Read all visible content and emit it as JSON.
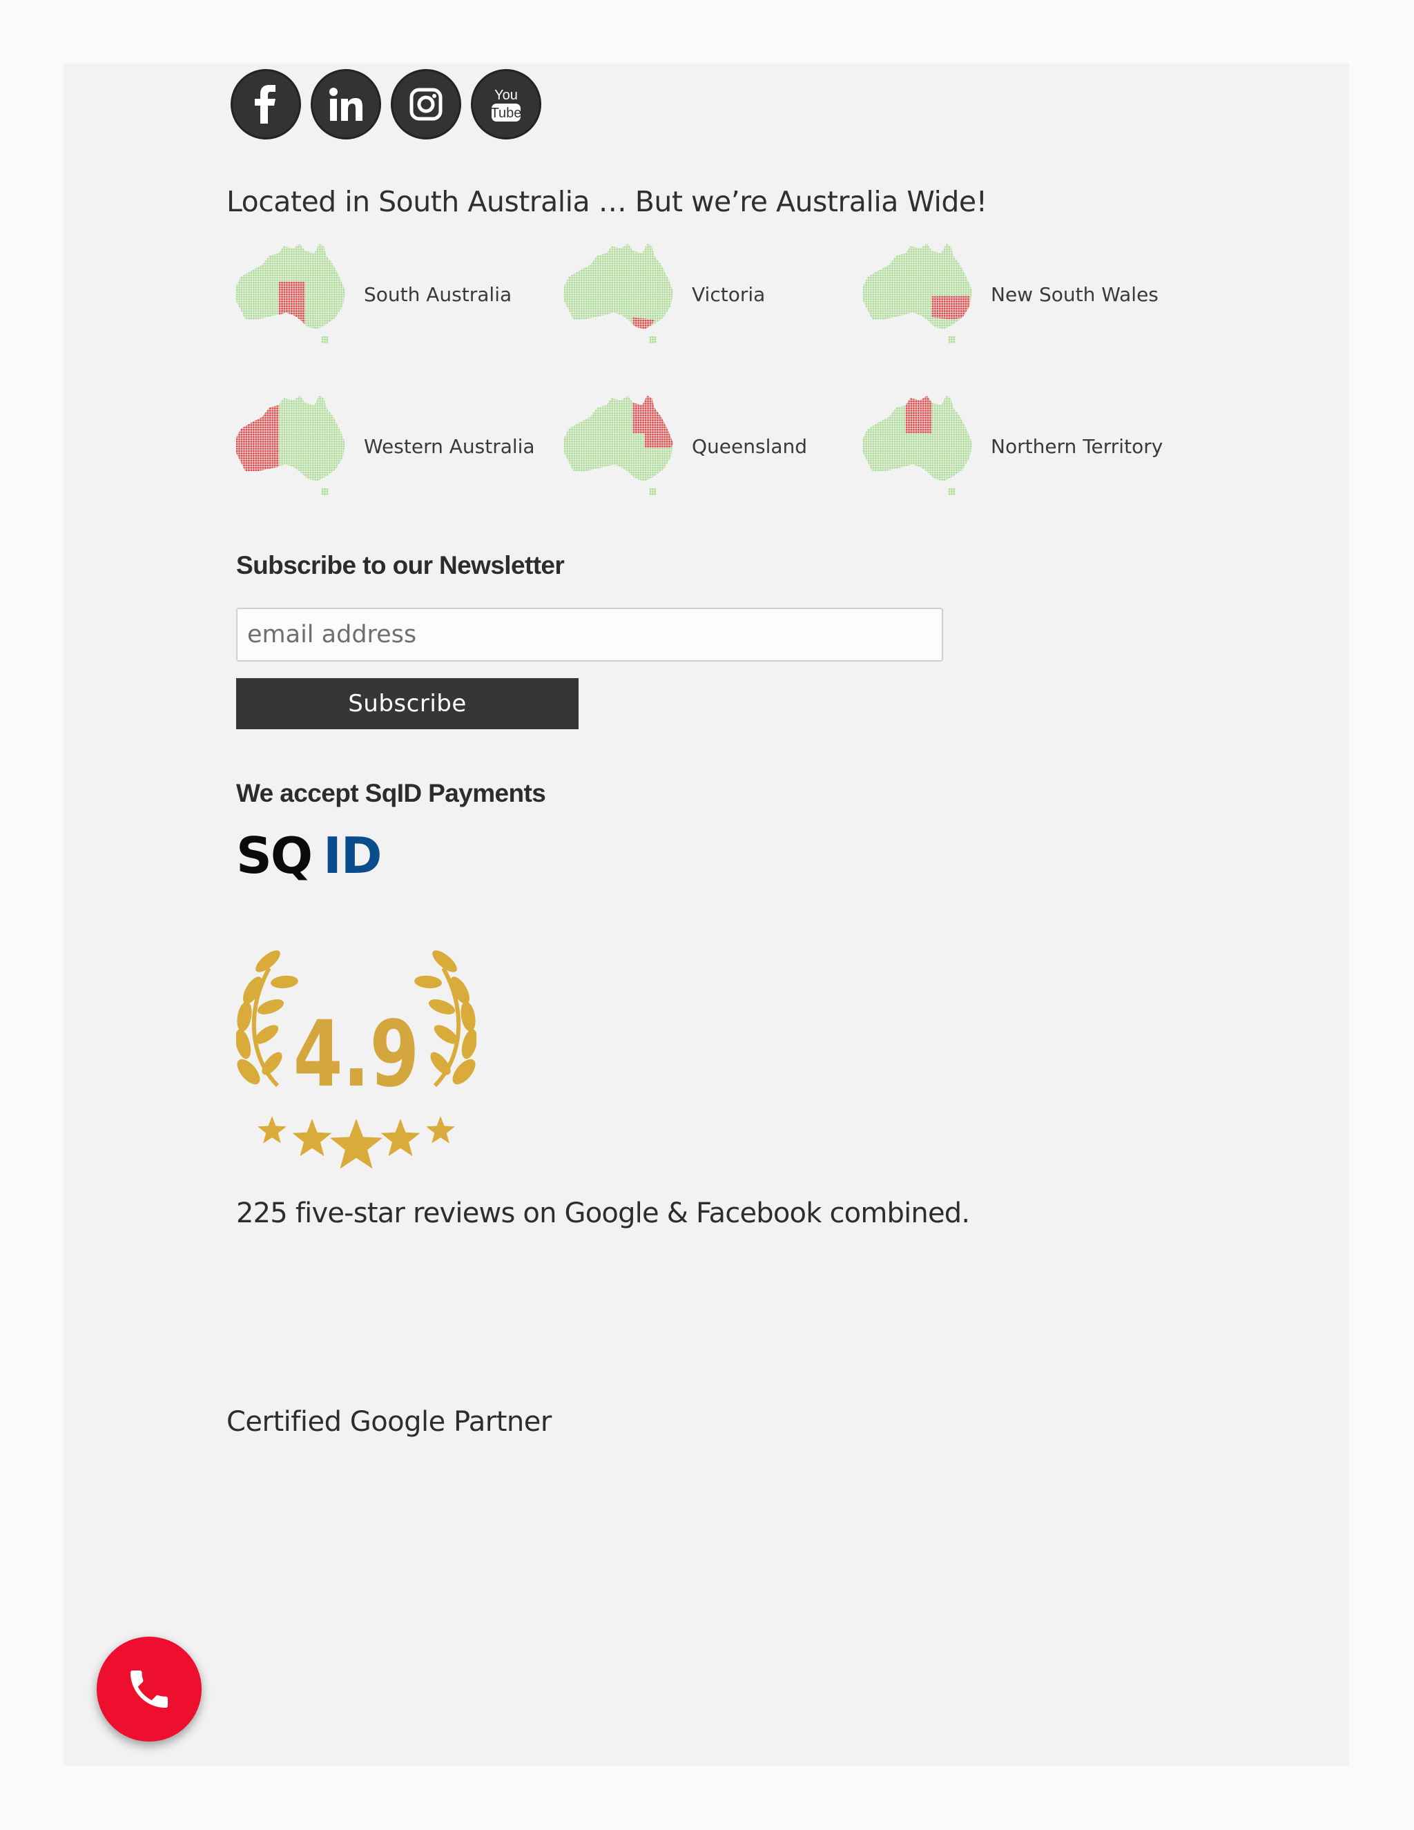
{
  "social": {
    "items": [
      {
        "name": "facebook",
        "icon": "facebook-icon"
      },
      {
        "name": "linkedin",
        "icon": "linkedin-icon"
      },
      {
        "name": "instagram",
        "icon": "instagram-icon"
      },
      {
        "name": "youtube",
        "icon": "youtube-icon",
        "text_top": "You",
        "text_bottom": "Tube"
      }
    ]
  },
  "coverage": {
    "heading": "Located in South Australia … But we’re Australia Wide!",
    "states": [
      {
        "label": "South Australia",
        "highlight": "SA"
      },
      {
        "label": "Victoria",
        "highlight": "VIC"
      },
      {
        "label": "New South Wales",
        "highlight": "NSW"
      },
      {
        "label": "Western Australia",
        "highlight": "WA"
      },
      {
        "label": "Queensland",
        "highlight": "QLD"
      },
      {
        "label": "Northern Territory",
        "highlight": "NT"
      }
    ]
  },
  "newsletter": {
    "heading": "Subscribe to our Newsletter",
    "email_placeholder": "email address",
    "button_label": "Subscribe"
  },
  "payments": {
    "heading": "We accept SqID Payments",
    "logo_text_dark": "SQ",
    "logo_text_blue": "ID"
  },
  "rating": {
    "value": "4.9",
    "stars": 5,
    "reviews_text": "225 five-star reviews on Google & Facebook combined."
  },
  "partner": {
    "text": "Certified Google Partner"
  },
  "colors": {
    "map_green": "#a9dc8f",
    "map_red": "#e8424f",
    "gold": "#d8ab3b",
    "sqid_blue": "#0b4d8c",
    "call_red": "#ee0f2f"
  },
  "call_button": {
    "icon": "phone-icon"
  }
}
